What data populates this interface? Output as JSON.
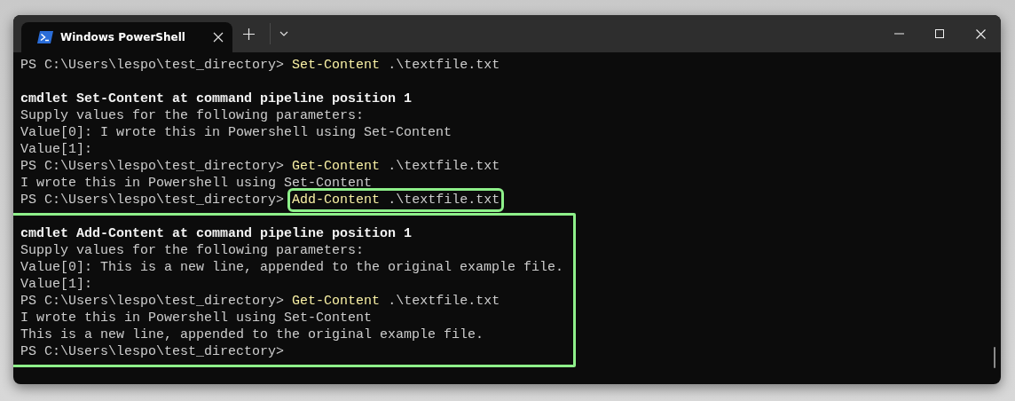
{
  "window": {
    "tab": {
      "title": "Windows PowerShell",
      "selected": true
    }
  },
  "blocks": [
    {
      "highlighted": false,
      "lines": [
        {
          "kind": "prompt",
          "prompt": "PS C:\\Users\\lespo\\test_directory>",
          "command": "Set-Content",
          "argument": ".\\textfile.txt",
          "highlighted": false
        },
        {
          "kind": "blank"
        },
        {
          "kind": "heading",
          "text": "cmdlet Set-Content at command pipeline position 1"
        },
        {
          "kind": "output",
          "text": "Supply values for the following parameters:"
        },
        {
          "kind": "output",
          "text": "Value[0]: I wrote this in Powershell using Set-Content"
        },
        {
          "kind": "output",
          "text": "Value[1]:"
        },
        {
          "kind": "prompt",
          "prompt": "PS C:\\Users\\lespo\\test_directory>",
          "command": "Get-Content",
          "argument": ".\\textfile.txt",
          "highlighted": false
        },
        {
          "kind": "output",
          "text": "I wrote this in Powershell using Set-Content"
        },
        {
          "kind": "prompt",
          "prompt": "PS C:\\Users\\lespo\\test_directory>",
          "command": "Add-Content",
          "argument": ".\\textfile.txt",
          "highlighted": true
        }
      ]
    },
    {
      "highlighted": true,
      "lines": [
        {
          "kind": "blank"
        },
        {
          "kind": "heading",
          "text": "cmdlet Add-Content at command pipeline position 1"
        },
        {
          "kind": "output",
          "text": "Supply values for the following parameters:"
        },
        {
          "kind": "output",
          "text": "Value[0]: This is a new line, appended to the original example file."
        },
        {
          "kind": "output",
          "text": "Value[1]:"
        },
        {
          "kind": "prompt",
          "prompt": "PS C:\\Users\\lespo\\test_directory>",
          "command": "Get-Content",
          "argument": ".\\textfile.txt",
          "highlighted": false
        },
        {
          "kind": "output",
          "text": "I wrote this in Powershell using Set-Content"
        },
        {
          "kind": "output",
          "text": "This is a new line, appended to the original example file."
        },
        {
          "kind": "prompt",
          "prompt": "PS C:\\Users\\lespo\\test_directory>",
          "highlighted": false
        }
      ]
    }
  ]
}
